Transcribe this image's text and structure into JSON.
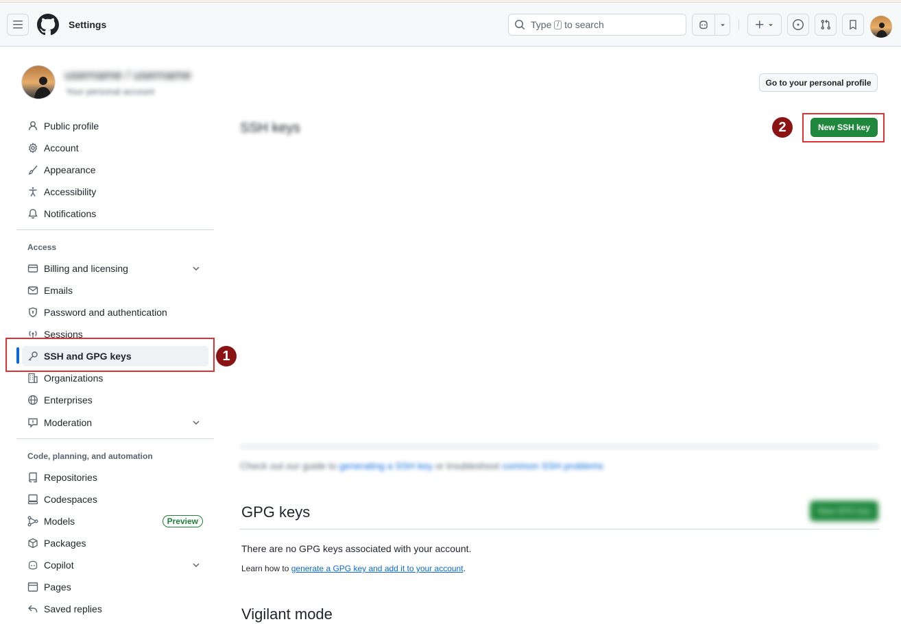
{
  "header": {
    "title": "Settings",
    "search_label": "Type",
    "search_key": "/",
    "search_suffix": "to search"
  },
  "user": {
    "name": "username / username",
    "subtitle": "Your personal account",
    "profile_button": "Go to your personal profile"
  },
  "sidebar": {
    "group1": [
      {
        "label": "Public profile",
        "icon": "person-icon"
      },
      {
        "label": "Account",
        "icon": "gear-icon"
      },
      {
        "label": "Appearance",
        "icon": "paintbrush-icon"
      },
      {
        "label": "Accessibility",
        "icon": "accessibility-icon"
      },
      {
        "label": "Notifications",
        "icon": "bell-icon"
      }
    ],
    "access_label": "Access",
    "access": [
      {
        "label": "Billing and licensing",
        "icon": "credit-card-icon"
      },
      {
        "label": "Emails",
        "icon": "mail-icon"
      },
      {
        "label": "Password and authentication",
        "icon": "shield-lock-icon"
      },
      {
        "label": "Sessions",
        "icon": "broadcast-icon"
      },
      {
        "label": "SSH and GPG keys",
        "icon": "key-icon"
      },
      {
        "label": "Organizations",
        "icon": "organization-icon"
      },
      {
        "label": "Enterprises",
        "icon": "globe-icon"
      },
      {
        "label": "Moderation",
        "icon": "report-icon"
      }
    ],
    "code_label": "Code, planning, and automation",
    "code": [
      {
        "label": "Repositories",
        "icon": "repo-icon"
      },
      {
        "label": "Codespaces",
        "icon": "codespaces-icon"
      },
      {
        "label": "Models",
        "icon": "models-icon",
        "badge": "Preview"
      },
      {
        "label": "Packages",
        "icon": "package-icon"
      },
      {
        "label": "Copilot",
        "icon": "copilot-icon"
      },
      {
        "label": "Pages",
        "icon": "browser-icon"
      },
      {
        "label": "Saved replies",
        "icon": "reply-icon"
      }
    ]
  },
  "main": {
    "ssh_title": "SSH keys",
    "new_ssh_button": "New SSH key",
    "ssh_guide_prefix": "Check out our guide to",
    "ssh_guide_link1": "generating a SSH key",
    "ssh_guide_middle": "or troubleshoot",
    "ssh_guide_link2": "common SSH problems",
    "gpg_title": "GPG keys",
    "gpg_button": "New GPG key",
    "gpg_empty": "There are no GPG keys associated with your account.",
    "gpg_learn_prefix": "Learn how to",
    "gpg_learn_link": "generate a GPG key and add it to your account",
    "gpg_learn_suffix": ".",
    "vigilant_title": "Vigilant mode"
  },
  "annotations": {
    "marker1": "1",
    "marker2": "2"
  },
  "colors": {
    "accent": "#0969da",
    "primary_button": "#1f883d",
    "annotation_box": "#e03131",
    "annotation_marker": "#8b1313"
  }
}
